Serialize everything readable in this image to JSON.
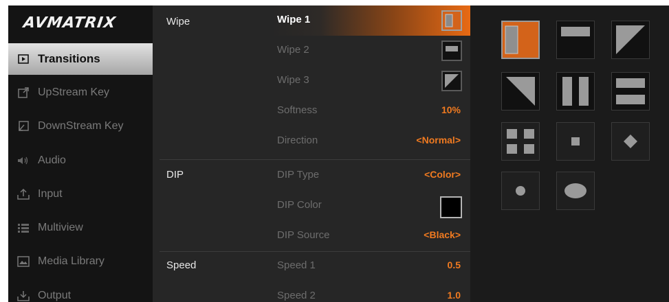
{
  "brand": {
    "logo": "AVMATRIX"
  },
  "sidebar": {
    "items": [
      {
        "label": "Transitions",
        "icon": "transitions-icon"
      },
      {
        "label": "UpStream Key",
        "icon": "upstream-key-icon"
      },
      {
        "label": "DownStream Key",
        "icon": "downstream-key-icon"
      },
      {
        "label": "Audio",
        "icon": "audio-icon"
      },
      {
        "label": "Input",
        "icon": "input-icon"
      },
      {
        "label": "Multiview",
        "icon": "multiview-icon"
      },
      {
        "label": "Media Library",
        "icon": "media-library-icon"
      },
      {
        "label": "Output",
        "icon": "output-icon"
      }
    ]
  },
  "panel": {
    "categories": {
      "wipe": "Wipe",
      "dip": "DIP",
      "speed": "Speed"
    },
    "rows": {
      "wipe1": {
        "label": "Wipe 1"
      },
      "wipe2": {
        "label": "Wipe 2"
      },
      "wipe3": {
        "label": "Wipe 3"
      },
      "softness": {
        "label": "Softness",
        "value": "10%"
      },
      "direction": {
        "label": "Direction",
        "value": "<Normal>"
      },
      "dip_type": {
        "label": "DIP Type",
        "value": "<Color>"
      },
      "dip_color": {
        "label": "DIP Color",
        "color": "#000000"
      },
      "dip_source": {
        "label": "DIP Source",
        "value": "<Black>"
      },
      "speed1": {
        "label": "Speed 1",
        "value": "0.5"
      },
      "speed2": {
        "label": "Speed 2",
        "value": "1.0"
      }
    }
  },
  "wipe_patterns": [
    "vertical-split-pattern",
    "horizontal-bar-pattern",
    "diagonal-top-right-pattern",
    "diagonal-bottom-left-pattern",
    "double-vertical-bar-pattern",
    "double-horizontal-bar-pattern",
    "four-squares-pattern",
    "center-square-pattern",
    "diamond-pattern",
    "circle-pattern",
    "ellipse-pattern"
  ],
  "colors": {
    "accent": "#f07a20",
    "selected_fill": "#d3631a"
  }
}
